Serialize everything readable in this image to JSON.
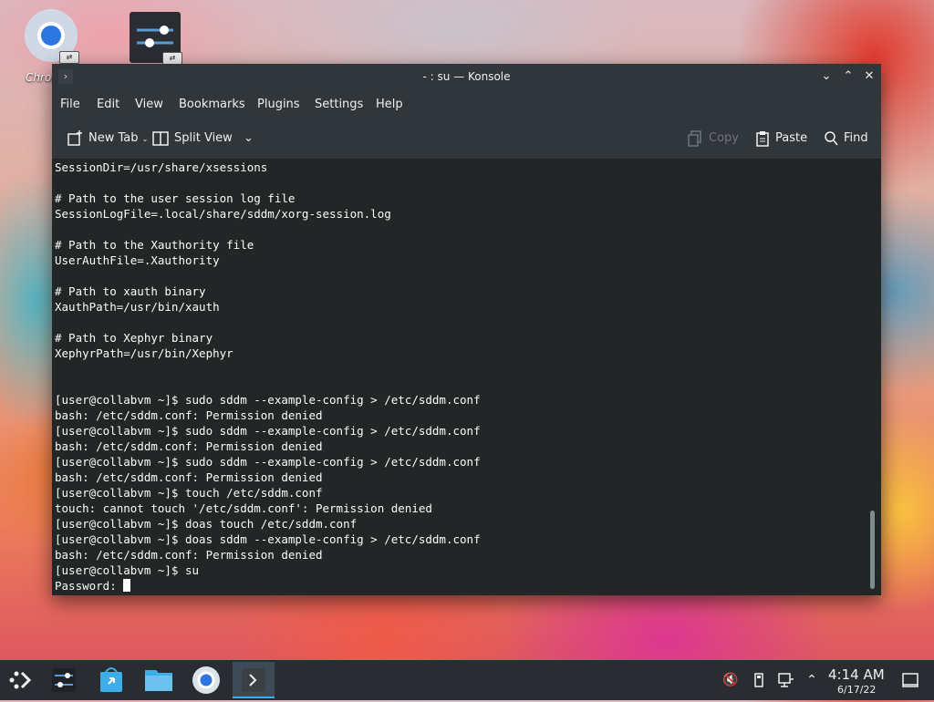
{
  "desktop": {
    "icons": [
      {
        "label": "Chrom"
      },
      {
        "label": ""
      }
    ]
  },
  "window": {
    "title": "- : su — Konsole",
    "menu": [
      "File",
      "Edit",
      "View",
      "Bookmarks",
      "Plugins",
      "Settings",
      "Help"
    ],
    "toolbar": {
      "new_tab": "New Tab",
      "split_view": "Split View",
      "copy": "Copy",
      "paste": "Paste",
      "find": "Find"
    }
  },
  "terminal": {
    "lines": [
      "SessionDir=/usr/share/xsessions",
      "",
      "# Path to the user session log file",
      "SessionLogFile=.local/share/sddm/xorg-session.log",
      "",
      "# Path to the Xauthority file",
      "UserAuthFile=.Xauthority",
      "",
      "# Path to xauth binary",
      "XauthPath=/usr/bin/xauth",
      "",
      "# Path to Xephyr binary",
      "XephyrPath=/usr/bin/Xephyr",
      "",
      "",
      "[user@collabvm ~]$ sudo sddm --example-config > /etc/sddm.conf",
      "bash: /etc/sddm.conf: Permission denied",
      "[user@collabvm ~]$ sudo sddm --example-config > /etc/sddm.conf",
      "bash: /etc/sddm.conf: Permission denied",
      "[user@collabvm ~]$ sudo sddm --example-config > /etc/sddm.conf",
      "bash: /etc/sddm.conf: Permission denied",
      "[user@collabvm ~]$ touch /etc/sddm.conf",
      "touch: cannot touch '/etc/sddm.conf': Permission denied",
      "[user@collabvm ~]$ doas touch /etc/sddm.conf",
      "[user@collabvm ~]$ doas sddm --example-config > /etc/sddm.conf",
      "bash: /etc/sddm.conf: Permission denied",
      "[user@collabvm ~]$ su"
    ],
    "prompt": "Password: "
  },
  "taskbar": {
    "time": "4:14 AM",
    "date": "6/17/22"
  },
  "colors": {
    "terminal_bg": "#232627",
    "chrome_bg": "#31363b",
    "accent": "#3daee9"
  }
}
